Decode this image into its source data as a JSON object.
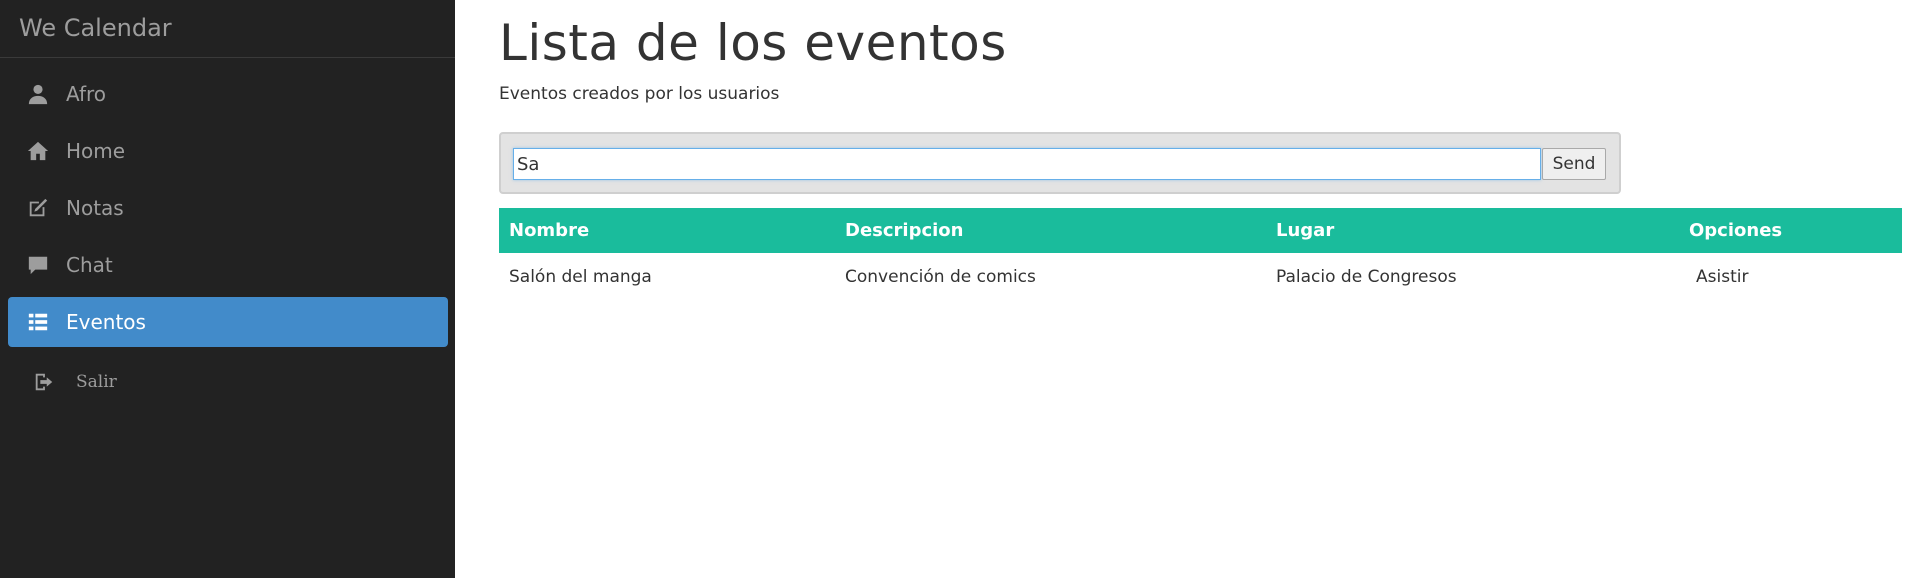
{
  "sidebar": {
    "brand": "We Calendar",
    "items": [
      {
        "label": "Afro",
        "icon": "user-icon"
      },
      {
        "label": "Home",
        "icon": "home-icon"
      },
      {
        "label": "Notas",
        "icon": "edit-icon"
      },
      {
        "label": "Chat",
        "icon": "comment-icon"
      },
      {
        "label": "Eventos",
        "icon": "list-icon",
        "active": true
      },
      {
        "label": "Salir",
        "icon": "logout-icon"
      }
    ]
  },
  "main": {
    "title": "Lista de los eventos",
    "subtitle": "Eventos creados por los usuarios",
    "search": {
      "value": "Sa",
      "button_label": "Send"
    },
    "table": {
      "headers": [
        "Nombre",
        "Descripcion",
        "Lugar",
        "Opciones"
      ],
      "rows": [
        {
          "nombre": "Salón del manga",
          "descripcion": "Convención de comics",
          "lugar": "Palacio de Congresos",
          "opcion": "Asistir"
        }
      ]
    }
  },
  "colors": {
    "sidebar_bg": "#222222",
    "active_item": "#428bca",
    "table_header": "#1abc9c"
  }
}
